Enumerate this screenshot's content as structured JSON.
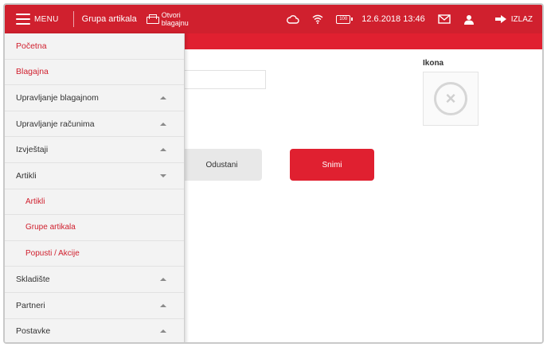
{
  "topbar": {
    "menu_label": "MENU",
    "group_label": "Grupa artikala",
    "open_register_label": "Otvori blagajnu",
    "battery_level": "100",
    "datetime": "12.6.2018 13:46",
    "logout_label": "IZLAZ"
  },
  "sidebar": {
    "items": [
      {
        "label": "Početna"
      },
      {
        "label": "Blagajna"
      },
      {
        "label": "Upravljanje blagajnom"
      },
      {
        "label": "Upravljanje računima"
      },
      {
        "label": "Izvještaji"
      },
      {
        "label": "Artikli"
      },
      {
        "label": "Artikli"
      },
      {
        "label": "Grupe artikala"
      },
      {
        "label": "Popusti / Akcije"
      },
      {
        "label": "Skladište"
      },
      {
        "label": "Partneri"
      },
      {
        "label": "Postavke"
      }
    ]
  },
  "main": {
    "icon_label": "Ikona",
    "cancel_label": "Odustani",
    "save_label": "Snimi"
  },
  "colors": {
    "accent": "#d0202e",
    "sidebar_bg": "#f3f3f3"
  }
}
